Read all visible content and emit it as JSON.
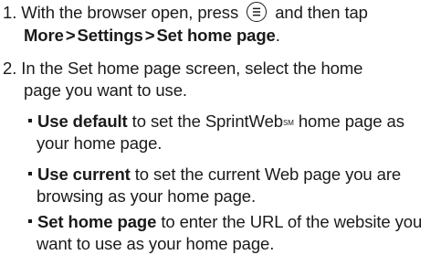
{
  "steps": [
    {
      "number": "1.",
      "line1_before": "With the browser open, press",
      "menu_key_icon": "menu-key-icon",
      "line1_after": "and then tap",
      "path": [
        "More",
        "Settings",
        "Set home page"
      ],
      "path_separator": ">",
      "path_end": "."
    },
    {
      "number": "2.",
      "line1": "In the Set home page screen, select the home",
      "line2": "page you want to use."
    }
  ],
  "options": [
    {
      "term": "Use default",
      "line1_rest": "to set the SprintWeb",
      "superscript": "SM",
      "line1_tail": "home page as",
      "line2": "your home page."
    },
    {
      "term": "Use current",
      "line1_rest": "to set the current Web page you are",
      "line2": "browsing as your home page."
    },
    {
      "term": "Set home page",
      "line1_rest": "to enter the URL of the website you",
      "line2": "want to use as your home page."
    }
  ]
}
